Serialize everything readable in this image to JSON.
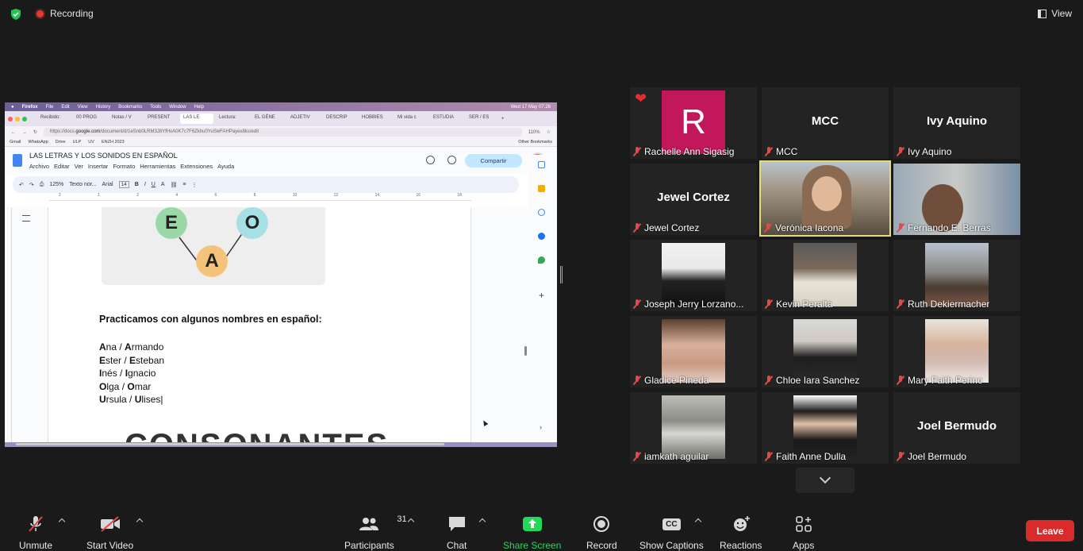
{
  "topbar": {
    "recording_label": "Recording",
    "view_label": "View"
  },
  "shared_screen": {
    "mac_menu": [
      "Firefox",
      "File",
      "Edit",
      "View",
      "History",
      "Bookmarks",
      "Tools",
      "Window",
      "Help"
    ],
    "mac_clock": "Wed 17 May  07:26",
    "browser_tabs": [
      "Recibido:",
      "00 PROG",
      "Notas / V",
      "PRESENT",
      "LAS LE",
      "Lectura:",
      "EL GÉNE",
      "ADJETIV",
      "DESCRIP",
      "HOBBIES",
      "Mi vida c",
      "ESTUDIA",
      "SER / ES"
    ],
    "url_prefix": "https://docs.",
    "url_domain": "google.com",
    "url_rest": "/document/d/1eSnb0LRM3J8YfHvA0K7c7F6Zkhu0YuSwFAHPayex8ks/edit",
    "zoom_pct": "110%",
    "bookmarks": [
      "Gmail",
      "WhatsApp",
      "Drive",
      "ULP",
      "UV",
      "ENZH 2023"
    ],
    "other_bookmarks": "Other Bookmarks",
    "doc_title": "LAS LETRAS Y LOS SONIDOS EN ESPAÑOL",
    "doc_menu": [
      "Archivo",
      "Editar",
      "Ver",
      "Insertar",
      "Formato",
      "Herramientas",
      "Extensiones",
      "Ayuda"
    ],
    "share_button": "Compartir",
    "toolbar": {
      "zoom": "125%",
      "style": "Texto nor...",
      "font": "Arial",
      "font_size": "14"
    },
    "ruler_marks": [
      "2",
      "1",
      "1",
      "2",
      "3",
      "4",
      "5",
      "6",
      "7",
      "8",
      "9",
      "10",
      "11",
      "12",
      "13",
      "14",
      "15",
      "16",
      "17",
      "18"
    ],
    "vowels": [
      "E",
      "O",
      "A"
    ],
    "practice_title": "Practicamos con algunos nombres en español:",
    "names": [
      {
        "b1": "A",
        "r1": "na / ",
        "b2": "A",
        "r2": "rmando"
      },
      {
        "b1": "E",
        "r1": "ster / ",
        "b2": "E",
        "r2": "steban"
      },
      {
        "b1": "I",
        "r1": "nés / ",
        "b2": "I",
        "r2": "gnacio"
      },
      {
        "b1": "O",
        "r1": "lga / ",
        "b2": "O",
        "r2": "mar"
      },
      {
        "b1": "U",
        "r1": "rsula / ",
        "b2": "U",
        "r2": "lises"
      }
    ],
    "consonantes": "CONSONANTES"
  },
  "participants": [
    {
      "name": "Rachelle Ann Sigasig",
      "kind": "initial",
      "initial": "R",
      "color": "#c2185b",
      "heart": "❤"
    },
    {
      "name": "MCC",
      "kind": "text",
      "display": "MCC"
    },
    {
      "name": "Ivy Aquino",
      "kind": "text",
      "display": "Ivy Aquino"
    },
    {
      "name": "Jewel Cortez",
      "kind": "text",
      "display": "Jewel Cortez"
    },
    {
      "name": "Verónica Iacona",
      "kind": "video",
      "active": true
    },
    {
      "name": "Fernando E. Berras",
      "kind": "video"
    },
    {
      "name": "Joseph Jerry Lorzano...",
      "kind": "photo"
    },
    {
      "name": "Kevin Peralta",
      "kind": "photo"
    },
    {
      "name": "Ruth Dekiermacher",
      "kind": "photo"
    },
    {
      "name": "Gladice Pineda",
      "kind": "photo"
    },
    {
      "name": "Chloe Iara Sanchez",
      "kind": "photo"
    },
    {
      "name": "Mary Faith Perino",
      "kind": "photo"
    },
    {
      "name": "iamkath aguilar",
      "kind": "photo"
    },
    {
      "name": "Faith Anne Dulla",
      "kind": "photo"
    },
    {
      "name": "Joel Bermudo",
      "kind": "text",
      "display": "Joel Bermudo"
    }
  ],
  "bottombar": {
    "unmute": "Unmute",
    "start_video": "Start Video",
    "participants": "Participants",
    "participant_count": "31",
    "chat": "Chat",
    "share_screen": "Share Screen",
    "record": "Record",
    "show_captions": "Show Captions",
    "captions_badge": "CC",
    "reactions": "Reactions",
    "apps": "Apps",
    "leave": "Leave"
  },
  "colors": {
    "share_green": "#23d959",
    "leave_red": "#d92b2b",
    "active_border": "#e4db7c"
  }
}
